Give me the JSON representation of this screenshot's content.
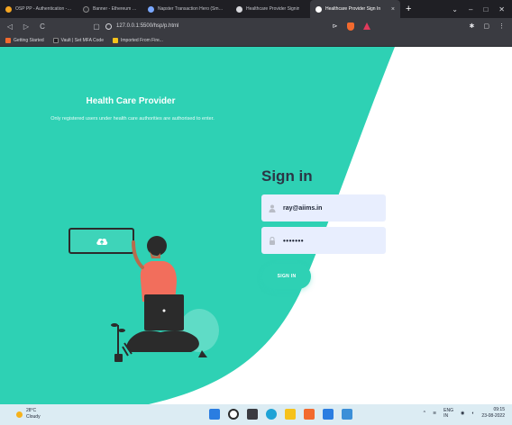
{
  "browser": {
    "tabs": [
      {
        "label": "OSP PP - Authentication - Fireba",
        "favicon_color": "#f5a623",
        "active": false
      },
      {
        "label": "Banner - Ethereum OIL",
        "favicon_color": "#3a3b41",
        "active": false
      },
      {
        "label": "Napster Transaction Hero (SmallBi",
        "favicon_color": "#7aa8ff",
        "active": false
      },
      {
        "label": "Healthcare Provider Signin",
        "favicon_color": "#d7d8dc",
        "active": false
      },
      {
        "label": "Healthcare Provider Sign In",
        "favicon_color": "#ffffff",
        "active": true
      }
    ],
    "new_tab_symbol": "+",
    "close_symbol": "×",
    "window_controls": [
      "⌄",
      "–",
      "□",
      "✕"
    ],
    "url": "127.0.0.1:5500/hsp/p.html",
    "nav": {
      "back": "◁",
      "forward": "▷",
      "reload": "C",
      "bookmark": "▢"
    },
    "bookmarks": [
      {
        "label": "Getting Started",
        "color": "#f26a2e"
      },
      {
        "label": "Vault | Set MFA Code",
        "color": "#1f1f24"
      },
      {
        "label": "Imported From Fire...",
        "color": "#f6c21b"
      }
    ]
  },
  "page": {
    "hero": {
      "title": "Health Care Provider",
      "subtitle": "Only registered users under health care authorities are authorised to enter."
    },
    "signin": {
      "title": "Sign in",
      "email_value": "ray@aiims.in",
      "password_value": "•••••••",
      "button_label": "SIGN IN"
    },
    "colors": {
      "accent": "#2ed1b4",
      "field_bg": "#e8eefe",
      "heading": "#2c3545"
    }
  },
  "taskbar": {
    "weather_temp": "28°C",
    "weather_desc": "Cloudy",
    "language": "ENG\nIN",
    "time": "09:15",
    "date": "23-08-2022"
  }
}
